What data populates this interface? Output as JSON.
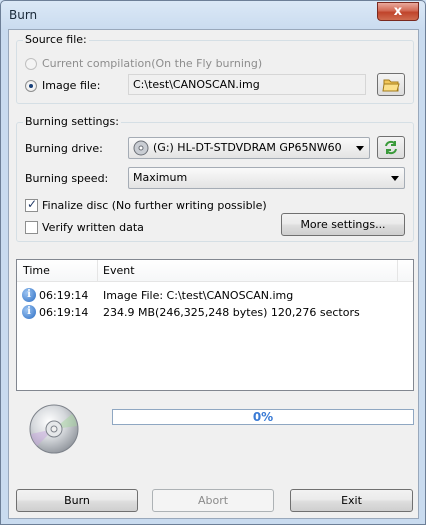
{
  "window": {
    "title": "Burn"
  },
  "titlebar": {
    "close_glyph": "x"
  },
  "source_group": {
    "label": "Source file:",
    "radio_compilation_label": "Current compilation(On the Fly burning)",
    "radio_image_label": "Image file:",
    "image_path": "C:\\test\\CANOSCAN.img",
    "browse_icon": "folder-icon"
  },
  "burning_group": {
    "label": "Burning settings:",
    "drive_label": "Burning drive:",
    "drive_value": "(G:) HL-DT-STDVDRAM GP65NW60",
    "refresh_icon": "refresh-icon",
    "speed_label": "Burning speed:",
    "speed_value": "Maximum",
    "finalize_label": "Finalize disc (No further writing possible)",
    "finalize_checked": true,
    "verify_label": "Verify written data",
    "verify_checked": false,
    "more_settings_label": "More settings..."
  },
  "log": {
    "columns": [
      "Time",
      "Event"
    ],
    "rows": [
      {
        "time": "06:19:14",
        "event": "Image File:  C:\\test\\CANOSCAN.img",
        "icon": "info-icon"
      },
      {
        "time": "06:19:14",
        "event": "234.9 MB(246,325,248 bytes)  120,276 sectors",
        "icon": "info-icon"
      }
    ]
  },
  "progress": {
    "value": 0,
    "text": "0%"
  },
  "buttons": {
    "burn": "Burn",
    "abort": "Abort",
    "exit": "Exit"
  }
}
